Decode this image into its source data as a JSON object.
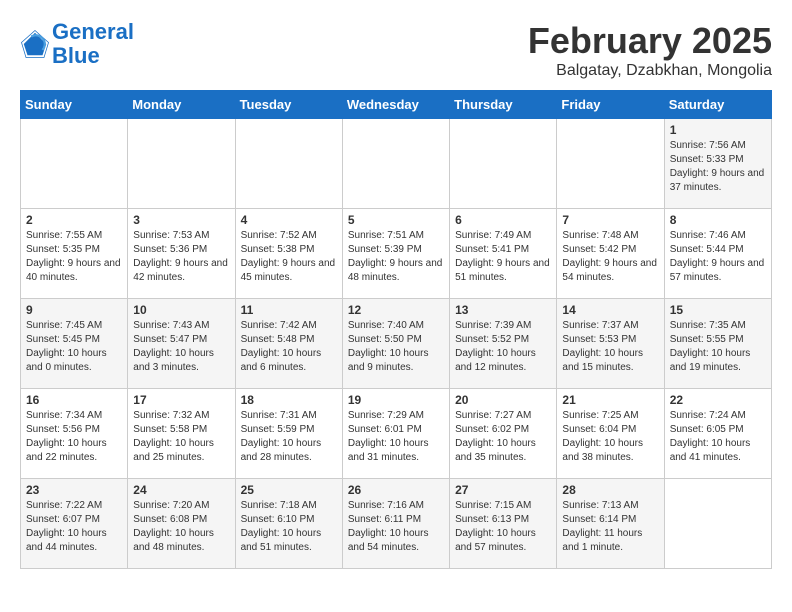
{
  "header": {
    "logo_line1": "General",
    "logo_line2": "Blue",
    "month": "February 2025",
    "location": "Balgatay, Dzabkhan, Mongolia"
  },
  "weekdays": [
    "Sunday",
    "Monday",
    "Tuesday",
    "Wednesday",
    "Thursday",
    "Friday",
    "Saturday"
  ],
  "weeks": [
    [
      {
        "day": "",
        "text": ""
      },
      {
        "day": "",
        "text": ""
      },
      {
        "day": "",
        "text": ""
      },
      {
        "day": "",
        "text": ""
      },
      {
        "day": "",
        "text": ""
      },
      {
        "day": "",
        "text": ""
      },
      {
        "day": "1",
        "text": "Sunrise: 7:56 AM\nSunset: 5:33 PM\nDaylight: 9 hours and 37 minutes."
      }
    ],
    [
      {
        "day": "2",
        "text": "Sunrise: 7:55 AM\nSunset: 5:35 PM\nDaylight: 9 hours and 40 minutes."
      },
      {
        "day": "3",
        "text": "Sunrise: 7:53 AM\nSunset: 5:36 PM\nDaylight: 9 hours and 42 minutes."
      },
      {
        "day": "4",
        "text": "Sunrise: 7:52 AM\nSunset: 5:38 PM\nDaylight: 9 hours and 45 minutes."
      },
      {
        "day": "5",
        "text": "Sunrise: 7:51 AM\nSunset: 5:39 PM\nDaylight: 9 hours and 48 minutes."
      },
      {
        "day": "6",
        "text": "Sunrise: 7:49 AM\nSunset: 5:41 PM\nDaylight: 9 hours and 51 minutes."
      },
      {
        "day": "7",
        "text": "Sunrise: 7:48 AM\nSunset: 5:42 PM\nDaylight: 9 hours and 54 minutes."
      },
      {
        "day": "8",
        "text": "Sunrise: 7:46 AM\nSunset: 5:44 PM\nDaylight: 9 hours and 57 minutes."
      }
    ],
    [
      {
        "day": "9",
        "text": "Sunrise: 7:45 AM\nSunset: 5:45 PM\nDaylight: 10 hours and 0 minutes."
      },
      {
        "day": "10",
        "text": "Sunrise: 7:43 AM\nSunset: 5:47 PM\nDaylight: 10 hours and 3 minutes."
      },
      {
        "day": "11",
        "text": "Sunrise: 7:42 AM\nSunset: 5:48 PM\nDaylight: 10 hours and 6 minutes."
      },
      {
        "day": "12",
        "text": "Sunrise: 7:40 AM\nSunset: 5:50 PM\nDaylight: 10 hours and 9 minutes."
      },
      {
        "day": "13",
        "text": "Sunrise: 7:39 AM\nSunset: 5:52 PM\nDaylight: 10 hours and 12 minutes."
      },
      {
        "day": "14",
        "text": "Sunrise: 7:37 AM\nSunset: 5:53 PM\nDaylight: 10 hours and 15 minutes."
      },
      {
        "day": "15",
        "text": "Sunrise: 7:35 AM\nSunset: 5:55 PM\nDaylight: 10 hours and 19 minutes."
      }
    ],
    [
      {
        "day": "16",
        "text": "Sunrise: 7:34 AM\nSunset: 5:56 PM\nDaylight: 10 hours and 22 minutes."
      },
      {
        "day": "17",
        "text": "Sunrise: 7:32 AM\nSunset: 5:58 PM\nDaylight: 10 hours and 25 minutes."
      },
      {
        "day": "18",
        "text": "Sunrise: 7:31 AM\nSunset: 5:59 PM\nDaylight: 10 hours and 28 minutes."
      },
      {
        "day": "19",
        "text": "Sunrise: 7:29 AM\nSunset: 6:01 PM\nDaylight: 10 hours and 31 minutes."
      },
      {
        "day": "20",
        "text": "Sunrise: 7:27 AM\nSunset: 6:02 PM\nDaylight: 10 hours and 35 minutes."
      },
      {
        "day": "21",
        "text": "Sunrise: 7:25 AM\nSunset: 6:04 PM\nDaylight: 10 hours and 38 minutes."
      },
      {
        "day": "22",
        "text": "Sunrise: 7:24 AM\nSunset: 6:05 PM\nDaylight: 10 hours and 41 minutes."
      }
    ],
    [
      {
        "day": "23",
        "text": "Sunrise: 7:22 AM\nSunset: 6:07 PM\nDaylight: 10 hours and 44 minutes."
      },
      {
        "day": "24",
        "text": "Sunrise: 7:20 AM\nSunset: 6:08 PM\nDaylight: 10 hours and 48 minutes."
      },
      {
        "day": "25",
        "text": "Sunrise: 7:18 AM\nSunset: 6:10 PM\nDaylight: 10 hours and 51 minutes."
      },
      {
        "day": "26",
        "text": "Sunrise: 7:16 AM\nSunset: 6:11 PM\nDaylight: 10 hours and 54 minutes."
      },
      {
        "day": "27",
        "text": "Sunrise: 7:15 AM\nSunset: 6:13 PM\nDaylight: 10 hours and 57 minutes."
      },
      {
        "day": "28",
        "text": "Sunrise: 7:13 AM\nSunset: 6:14 PM\nDaylight: 11 hours and 1 minute."
      },
      {
        "day": "",
        "text": ""
      }
    ]
  ]
}
